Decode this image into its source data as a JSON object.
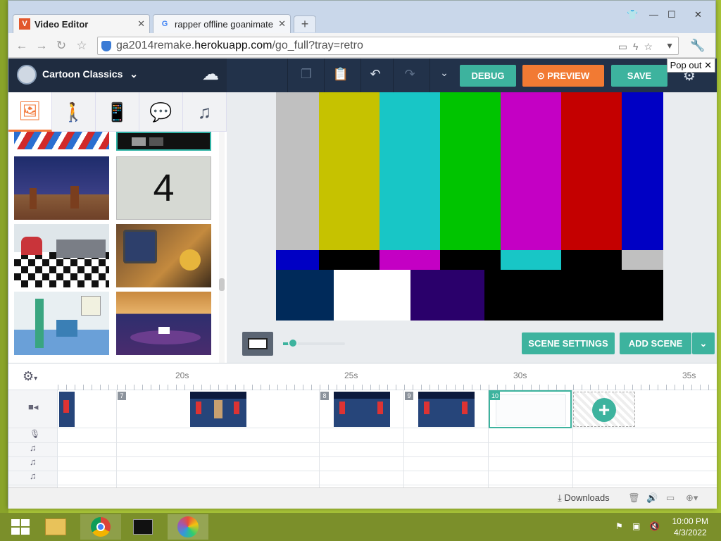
{
  "browser": {
    "tabs": [
      {
        "label": "Video Editor",
        "favicon": "V"
      },
      {
        "label": "rapper offline goanimate",
        "favicon": "G"
      }
    ],
    "address": {
      "prefix": "ga2014remake.",
      "host": "herokuapp.com",
      "path": "/go_full?tray=retro"
    }
  },
  "editor": {
    "theme_name": "Cartoon Classics",
    "buttons": {
      "debug": "DEBUG",
      "preview": "PREVIEW",
      "save": "SAVE",
      "scene_settings": "SCENE SETTINGS",
      "add_scene": "ADD SCENE"
    },
    "popout": "Pop out",
    "library": {
      "tabs": [
        "backgrounds",
        "characters",
        "props",
        "text",
        "sound"
      ],
      "countdown_label": "4"
    },
    "colors": {
      "accent_green": "#3db39e",
      "accent_orange": "#f27a33",
      "navy": "#22324a"
    }
  },
  "timeline": {
    "ticks": [
      "20s",
      "25s",
      "30s",
      "35s"
    ],
    "scene_numbers": [
      "7",
      "8",
      "9",
      "10"
    ]
  },
  "statusbar": {
    "downloads": "Downloads"
  },
  "taskbar": {
    "time": "10:00 PM",
    "date": "4/3/2022"
  }
}
